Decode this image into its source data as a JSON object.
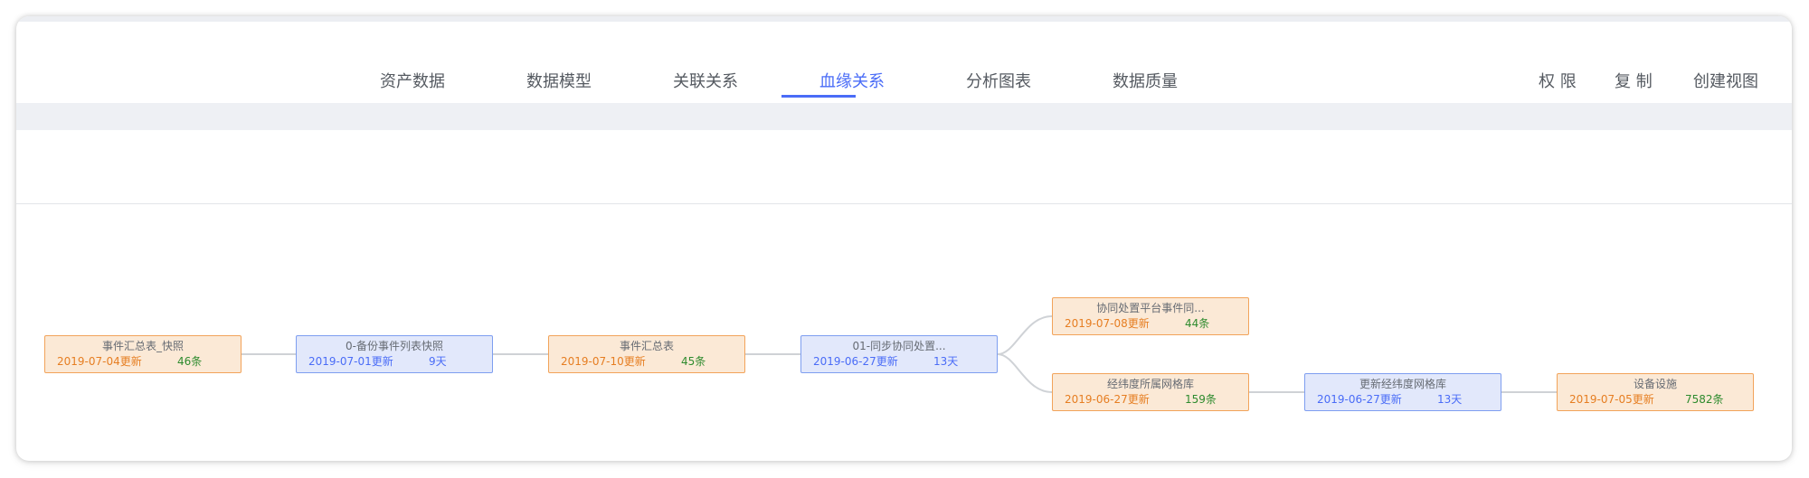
{
  "tabs": [
    {
      "label": "资产数据"
    },
    {
      "label": "数据模型"
    },
    {
      "label": "关联关系"
    },
    {
      "label": "血缘关系"
    },
    {
      "label": "分析图表"
    },
    {
      "label": "数据质量"
    }
  ],
  "active_tab": "血缘关系",
  "actions": {
    "permission": "权 限",
    "copy": "复 制",
    "create_view": "创建视图"
  },
  "colors": {
    "accent": "#4a6cf7",
    "table_node_bg": "#fbe9d6",
    "table_node_border": "#f2a35a",
    "task_node_bg": "#e2e8fb",
    "task_node_border": "#7e9ef0",
    "count_text": "#2e8b2e"
  },
  "lineage": {
    "nodes": [
      {
        "title": "事件汇总表_快照",
        "date": "2019-07-04更新",
        "meta": "46条",
        "kind": "table"
      },
      {
        "title": "0-备份事件列表快照",
        "date": "2019-07-01更新",
        "meta": "9天",
        "kind": "task"
      },
      {
        "title": "事件汇总表",
        "date": "2019-07-10更新",
        "meta": "45条",
        "kind": "table"
      },
      {
        "title": "01-同步协同处置...",
        "date": "2019-06-27更新",
        "meta": "13天",
        "kind": "task"
      },
      {
        "title": "协同处置平台事件同...",
        "date": "2019-07-08更新",
        "meta": "44条",
        "kind": "table"
      },
      {
        "title": "经纬度所属网格库",
        "date": "2019-06-27更新",
        "meta": "159条",
        "kind": "table"
      },
      {
        "title": "更新经纬度网格库",
        "date": "2019-06-27更新",
        "meta": "13天",
        "kind": "task"
      },
      {
        "title": "设备设施",
        "date": "2019-07-05更新",
        "meta": "7582条",
        "kind": "table"
      }
    ]
  }
}
